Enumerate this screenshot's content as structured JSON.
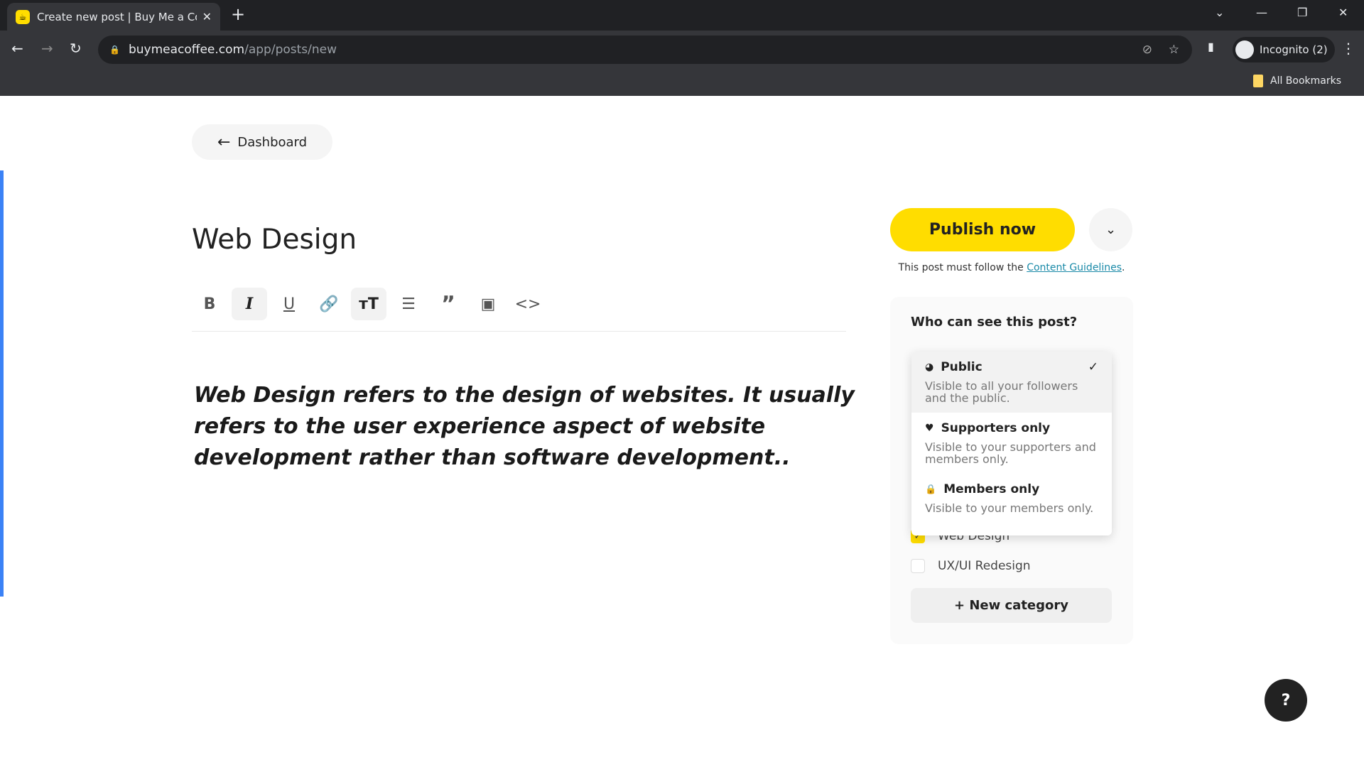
{
  "browser": {
    "tab_title": "Create new post | Buy Me a Coffee",
    "url_host": "buymeacoffee.com",
    "url_path": "/app/posts/new",
    "profile": "Incognito (2)",
    "bookmarks": "All Bookmarks"
  },
  "header": {
    "back_label": "Dashboard"
  },
  "editor": {
    "title": "Web Design",
    "body": "Web Design refers to the design of websites. It usually refers to the user experience aspect of website development rather than software development..",
    "toolbar": [
      "bold",
      "italic",
      "underline",
      "link",
      "text-size",
      "list",
      "quote",
      "image",
      "code"
    ]
  },
  "publish": {
    "label": "Publish now",
    "guidelines_prefix": "This post must follow the ",
    "guidelines_link": "Content Guidelines",
    "guidelines_suffix": "."
  },
  "visibility": {
    "heading": "Who can see this post?",
    "options": [
      {
        "label": "Public",
        "desc": "Visible to all your followers and the public.",
        "icon": "globe-icon",
        "selected": true
      },
      {
        "label": "Supporters only",
        "desc": "Visible to your supporters and members only.",
        "icon": "heart-icon"
      },
      {
        "label": "Members only",
        "desc": "Visible to your members only.",
        "icon": "lock-icon"
      }
    ]
  },
  "categories": {
    "items": [
      {
        "label": "Web Design",
        "checked": true
      },
      {
        "label": "UX/UI Redesign",
        "checked": false
      }
    ],
    "new_label": "+ New category"
  },
  "help": {
    "label": "?"
  },
  "colors": {
    "accent": "#ffdd00"
  }
}
